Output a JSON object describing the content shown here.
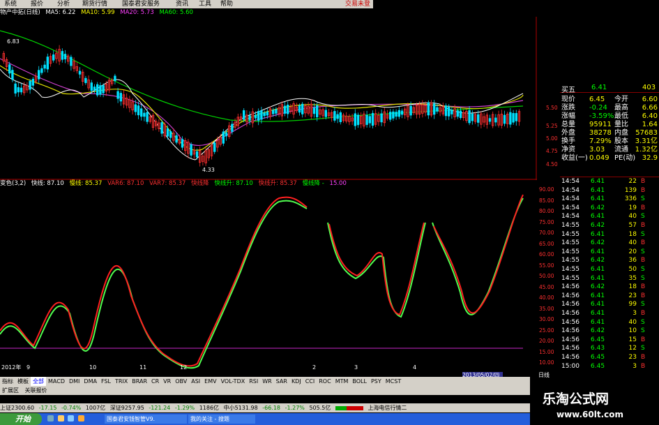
{
  "menu": {
    "items": [
      "系统",
      "报价",
      "分析",
      "期货行情",
      "国泰君安服务",
      "资讯",
      "工具",
      "帮助"
    ],
    "trade": "交易未登"
  },
  "ma_line": {
    "stock": "物产中拓(日线)",
    "ma5": "MA5: 6.22",
    "ma10": "MA10: 5.99",
    "ma20": "MA20: 5.73",
    "ma60": "MA60: 5.60"
  },
  "kdj_line": {
    "name": "变色(3,2)",
    "fast": "快线: 87.10",
    "slow": "慢线: 85.37",
    "var6": "VAR6: 87.10",
    "var7": "VAR7: 85.37",
    "down1": "快线降",
    "up": "快线升: 87.10",
    "down2": "快线升: 85.37",
    "down3": "慢线降 -",
    "val": "15.00"
  },
  "price_annotations": {
    "high": "6.83",
    "low": "4.33"
  },
  "price_axis": [
    "5.50",
    "5.25",
    "5.00",
    "4.75",
    "4.50"
  ],
  "kdj_axis": [
    "90.00",
    "85.00",
    "80.00",
    "75.00",
    "70.00",
    "65.00",
    "60.00",
    "55.00",
    "50.00",
    "45.00",
    "40.00",
    "35.00",
    "30.00",
    "25.00",
    "20.00",
    "15.00",
    "10.00"
  ],
  "date_labels": [
    "2012年",
    "9",
    "10",
    "11",
    "12",
    "2",
    "3",
    "4"
  ],
  "date_box": "2013/05/02/四",
  "period_btn": "日线",
  "quote": [
    {
      "l": "买五",
      "v": "6.41",
      "r": "",
      "rv": "403"
    },
    {
      "l": "现价",
      "v": "6.45",
      "r": "今开",
      "rv": "6.60"
    },
    {
      "l": "涨跌",
      "v": "-0.24",
      "r": "最高",
      "rv": "6.66"
    },
    {
      "l": "涨幅",
      "v": "-3.59%",
      "r": "最低",
      "rv": "6.40"
    },
    {
      "l": "总量",
      "v": "95911",
      "r": "量比",
      "rv": "1.64"
    },
    {
      "l": "外盘",
      "v": "38278",
      "r": "内盘",
      "rv": "57683"
    },
    {
      "l": "换手",
      "v": "7.29%",
      "r": "股本",
      "rv": "3.31亿"
    },
    {
      "l": "净资",
      "v": "3.03",
      "r": "流通",
      "rv": "1.32亿"
    },
    {
      "l": "收益(一)",
      "v": "0.049",
      "r": "PE(动)",
      "rv": "32.9"
    }
  ],
  "ticks": [
    {
      "t": "14:54",
      "p": "6.41",
      "v": "22",
      "s": "B"
    },
    {
      "t": "14:54",
      "p": "6.41",
      "v": "139",
      "s": "B"
    },
    {
      "t": "14:54",
      "p": "6.41",
      "v": "336",
      "s": "S"
    },
    {
      "t": "14:54",
      "p": "6.42",
      "v": "19",
      "s": "B"
    },
    {
      "t": "14:54",
      "p": "6.41",
      "v": "40",
      "s": "S"
    },
    {
      "t": "14:55",
      "p": "6.42",
      "v": "57",
      "s": "B"
    },
    {
      "t": "14:55",
      "p": "6.41",
      "v": "18",
      "s": "S"
    },
    {
      "t": "14:55",
      "p": "6.42",
      "v": "40",
      "s": "B"
    },
    {
      "t": "14:55",
      "p": "6.41",
      "v": "20",
      "s": "S"
    },
    {
      "t": "14:55",
      "p": "6.42",
      "v": "36",
      "s": "B"
    },
    {
      "t": "14:55",
      "p": "6.41",
      "v": "50",
      "s": "S"
    },
    {
      "t": "14:55",
      "p": "6.41",
      "v": "35",
      "s": "S"
    },
    {
      "t": "14:56",
      "p": "6.42",
      "v": "18",
      "s": "B"
    },
    {
      "t": "14:56",
      "p": "6.41",
      "v": "23",
      "s": "B"
    },
    {
      "t": "14:56",
      "p": "6.41",
      "v": "99",
      "s": "S"
    },
    {
      "t": "14:56",
      "p": "6.41",
      "v": "3",
      "s": "B"
    },
    {
      "t": "14:56",
      "p": "6.41",
      "v": "40",
      "s": "S"
    },
    {
      "t": "14:56",
      "p": "6.42",
      "v": "10",
      "s": "S"
    },
    {
      "t": "14:56",
      "p": "6.45",
      "v": "15",
      "s": "B"
    },
    {
      "t": "14:56",
      "p": "6.43",
      "v": "12",
      "s": "S"
    },
    {
      "t": "14:56",
      "p": "6.45",
      "v": "23",
      "s": "B"
    },
    {
      "t": "15:00",
      "p": "6.45",
      "v": "3",
      "s": "B"
    }
  ],
  "indicator_tabs": [
    "指标",
    "模板",
    "全部",
    "MACD",
    "DMI",
    "DMA",
    "FSL",
    "TRIX",
    "BRAR",
    "CR",
    "VR",
    "OBV",
    "ASI",
    "EMV",
    "VOL-TDX",
    "RSI",
    "WR",
    "SAR",
    "KDJ",
    "CCI",
    "ROC",
    "MTM",
    "BOLL",
    "PSY",
    "MCST"
  ],
  "tabs2": [
    "扩展区",
    "关联报价"
  ],
  "status": {
    "sh": "上证2300.60",
    "sh_chg": "-17.15",
    "sh_pct": "-0.74%",
    "sh_amt": "1007亿",
    "sz": "深证9257.95",
    "sz_chg": "-121.24",
    "sz_pct": "-1.29%",
    "sz_amt": "1186亿",
    "zx": "中小5131.98",
    "zx_chg": "-66.18",
    "zx_pct": "-1.27%",
    "zx_amt": "505.5亿",
    "server": "上海电信行情二"
  },
  "taskbar": {
    "start": "开始",
    "items": [
      "国泰君安钱智管V9.",
      "我的关注 - 搜题"
    ]
  },
  "watermark": {
    "title": "乐淘公式网",
    "url": "www.60lt.com"
  },
  "colors": {
    "up": "#ff3030",
    "down": "#00e0ff",
    "fast": "#ff2020",
    "slow": "#40ff40",
    "ma5": "#ffffff",
    "ma10": "#ffff00",
    "ma20": "#ff40ff",
    "ma60": "#00ff00"
  }
}
